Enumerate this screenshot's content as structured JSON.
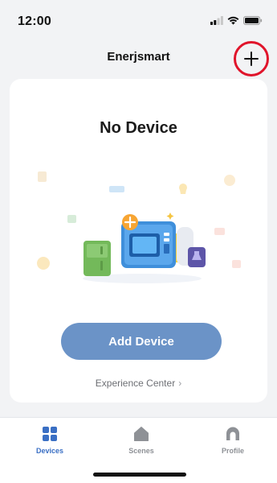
{
  "status_bar": {
    "time": "12:00"
  },
  "header": {
    "title": "Enerjsmart"
  },
  "empty_state": {
    "title": "No Device",
    "add_device_label": "Add Device",
    "experience_center_label": "Experience Center",
    "experience_center_chevron": "›"
  },
  "tabs": [
    {
      "label": "Devices",
      "icon": "grid-icon",
      "active": true
    },
    {
      "label": "Scenes",
      "icon": "house-icon",
      "active": false
    },
    {
      "label": "Profile",
      "icon": "profile-icon",
      "active": false
    }
  ],
  "colors": {
    "accent": "#3a6fc4",
    "button": "#6b93c7",
    "highlight_ring": "#e0142b",
    "background": "#f2f3f5"
  }
}
